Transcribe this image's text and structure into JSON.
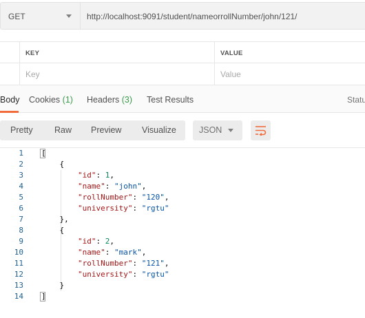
{
  "request": {
    "method": "GET",
    "url": "http://localhost:9091/student/nameorrollNumber/john/121/"
  },
  "params": {
    "key_header": "KEY",
    "value_header": "VALUE",
    "key_placeholder": "Key",
    "value_placeholder": "Value"
  },
  "response_tabs": {
    "body": "Body",
    "cookies": "Cookies",
    "cookies_count": "(1)",
    "headers": "Headers",
    "headers_count": "(3)",
    "tests": "Test Results",
    "status": "Status"
  },
  "view": {
    "modes": [
      "Pretty",
      "Raw",
      "Preview",
      "Visualize"
    ],
    "format": "JSON"
  },
  "code_lines": [
    {
      "num": "1",
      "text": "["
    },
    {
      "num": "2",
      "text": "    {"
    },
    {
      "num": "3",
      "key": "\"id\"",
      "val": "1",
      "vtype": "n",
      "comma": true
    },
    {
      "num": "4",
      "key": "\"name\"",
      "val": "\"john\"",
      "vtype": "s",
      "comma": true
    },
    {
      "num": "5",
      "key": "\"rollNumber\"",
      "val": "\"120\"",
      "vtype": "s",
      "comma": true
    },
    {
      "num": "6",
      "key": "\"university\"",
      "val": "\"rgtu\"",
      "vtype": "s",
      "comma": false
    },
    {
      "num": "7",
      "text": "    },"
    },
    {
      "num": "8",
      "text": "    {"
    },
    {
      "num": "9",
      "key": "\"id\"",
      "val": "2",
      "vtype": "n",
      "comma": true
    },
    {
      "num": "10",
      "key": "\"name\"",
      "val": "\"mark\"",
      "vtype": "s",
      "comma": true
    },
    {
      "num": "11",
      "key": "\"rollNumber\"",
      "val": "\"121\"",
      "vtype": "s",
      "comma": true
    },
    {
      "num": "12",
      "key": "\"university\"",
      "val": "\"rgtu\"",
      "vtype": "s",
      "comma": false
    },
    {
      "num": "13",
      "text": "    }"
    },
    {
      "num": "14",
      "text": "]"
    }
  ],
  "colors": {
    "accent": "#f26b3a",
    "count_green": "#3a9b4a",
    "json_key": "#a31515",
    "json_string": "#0451a5",
    "json_number": "#098658"
  }
}
